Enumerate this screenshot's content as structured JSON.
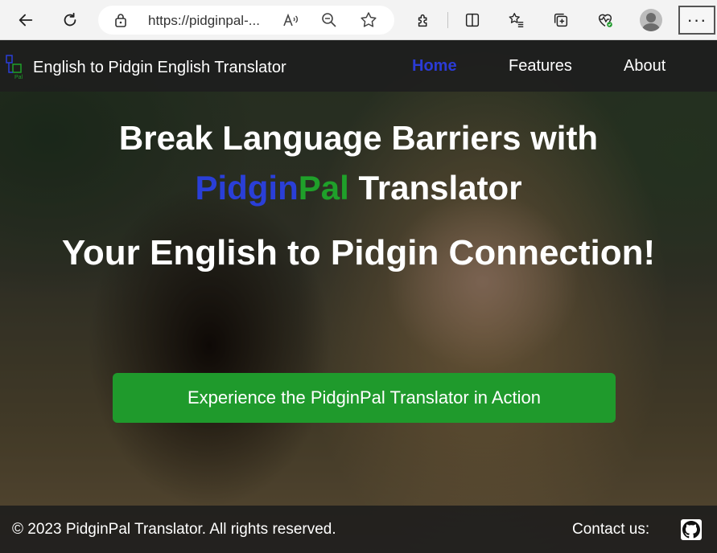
{
  "browser": {
    "url": "https://pidginpal-...",
    "icons": [
      "back-icon",
      "refresh-icon",
      "lock-icon",
      "read-aloud-icon",
      "zoom-icon",
      "favorite-icon",
      "extensions-icon",
      "split-screen-icon",
      "favorites-list-icon",
      "collections-icon",
      "health-icon",
      "profile-icon",
      "more-icon"
    ],
    "more_label": "···"
  },
  "nav": {
    "brand": "English to Pidgin English Translator",
    "logo_letters": "Pal",
    "links": [
      {
        "label": "Home"
      },
      {
        "label": "Features"
      },
      {
        "label": "About"
      }
    ]
  },
  "hero": {
    "line1": "Break Language Barriers with",
    "line2_pidgin": "Pidgin",
    "line2_pal": "Pal",
    "line2_rest": " Translator",
    "line3": "Your English to Pidgin Connection!",
    "cta": "Experience the PidginPal Translator in Action"
  },
  "footer": {
    "copyright": "© 2023 PidginPal Translator. All rights reserved.",
    "contact": "Contact us:",
    "icon": "github-icon"
  },
  "colors": {
    "accent_blue": "#2a3fd8",
    "accent_green": "#1fa02a",
    "cta_green": "#1f9a2c",
    "nav_bg": "#1e1e1e"
  }
}
